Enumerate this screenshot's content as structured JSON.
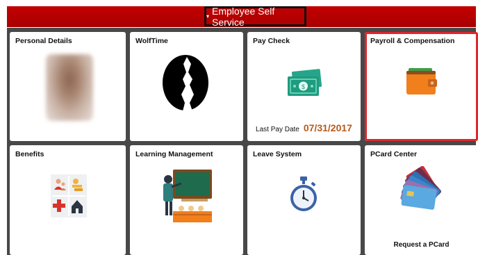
{
  "header": {
    "title": "Employee Self Service",
    "caret": "▾",
    "banner_color": "#b50000"
  },
  "tiles": [
    {
      "label": "Personal Details",
      "icon": "user-photo"
    },
    {
      "label": "WolfTime",
      "icon": "wolf-icon"
    },
    {
      "label": "Pay Check",
      "icon": "money-icon",
      "last_pay_label": "Last Pay Date",
      "last_pay_date": "07/31/2017"
    },
    {
      "label": "Payroll & Compensation",
      "icon": "wallet-icon",
      "selected": true
    },
    {
      "label": "Benefits",
      "icon": "benefits-icon"
    },
    {
      "label": "Learning Management",
      "icon": "teacher-icon"
    },
    {
      "label": "Leave System",
      "icon": "stopwatch-icon"
    },
    {
      "label": "PCard Center",
      "icon": "credit-cards-icon",
      "action_label": "Request a PCard"
    }
  ],
  "colors": {
    "selected_border": "#e0262b",
    "date_text": "#b65a19"
  }
}
